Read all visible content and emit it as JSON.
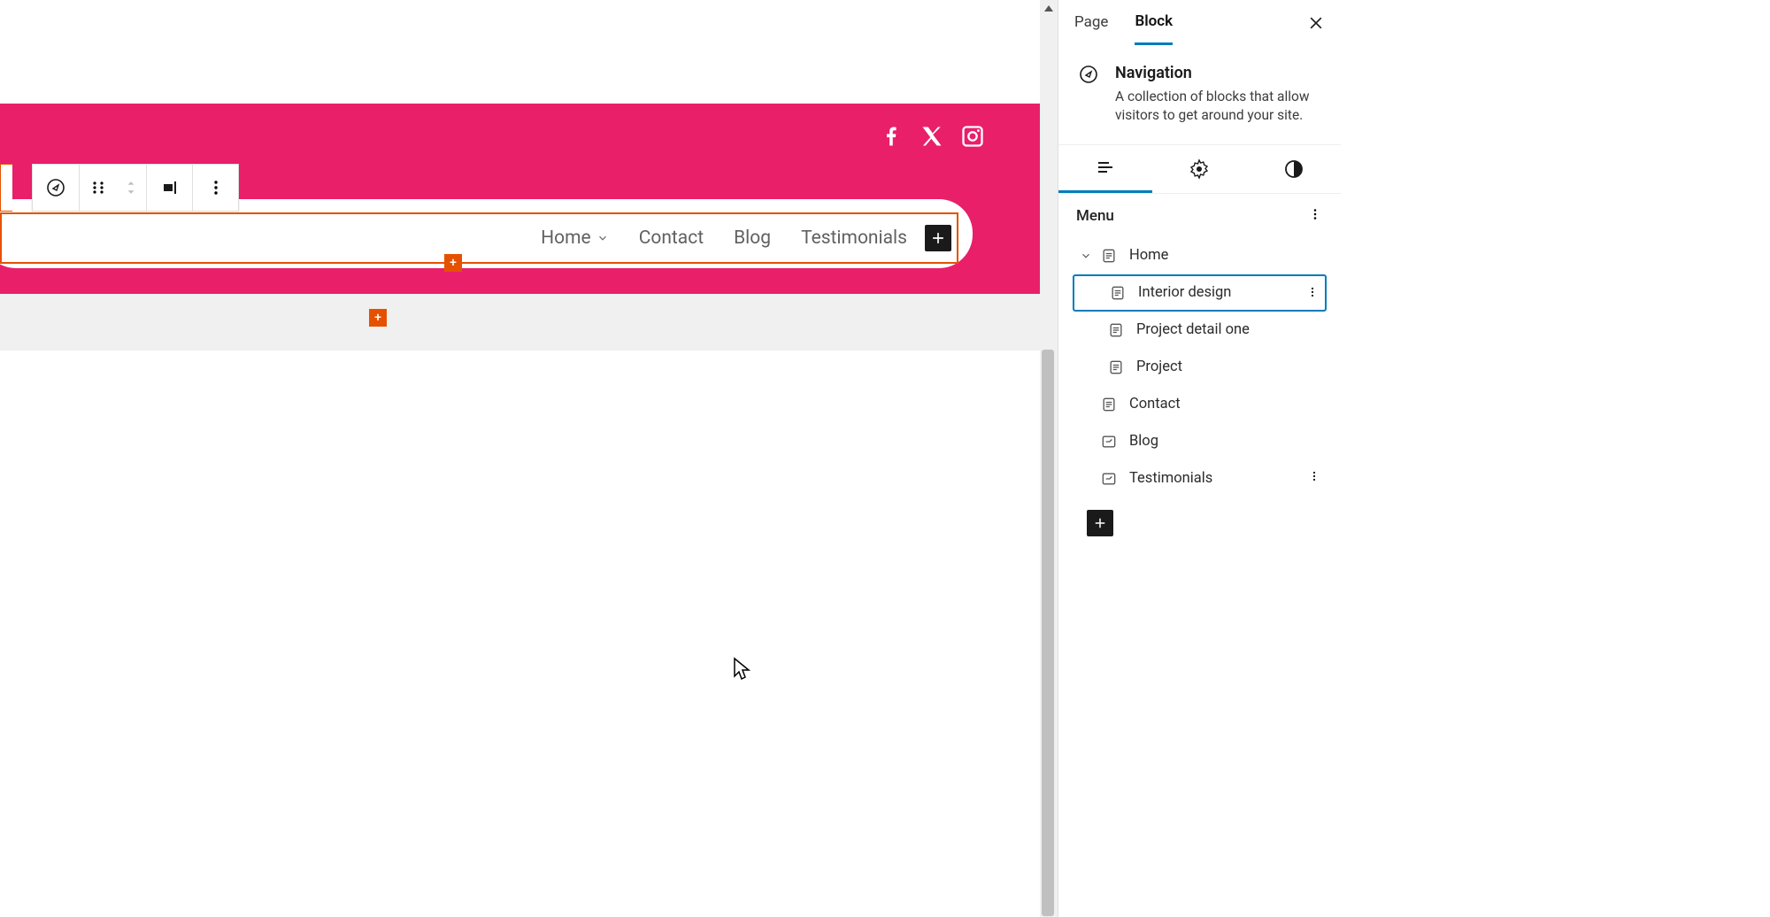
{
  "canvas": {
    "nav_items": [
      "Home",
      "Contact",
      "Blog",
      "Testimonials"
    ],
    "nav_dropdown_index": 0,
    "hero_bg": "#e91f6a",
    "nav_outline": "#e65100",
    "socials": [
      "facebook",
      "x-twitter",
      "instagram"
    ]
  },
  "sidebar": {
    "tabs": {
      "page": "Page",
      "block": "Block",
      "active": "Block"
    },
    "block": {
      "title": "Navigation",
      "desc": "A collection of blocks that allow visitors to get around your site."
    },
    "sub_tabs": {
      "active": "list"
    },
    "menu": {
      "heading": "Menu",
      "items": [
        {
          "label": "Home",
          "level": 0,
          "icon": "page",
          "expandable": true,
          "expanded": true
        },
        {
          "label": "Interior design",
          "level": 1,
          "icon": "page",
          "selected": true
        },
        {
          "label": "Project detail one",
          "level": 1,
          "icon": "page"
        },
        {
          "label": "Project",
          "level": 1,
          "icon": "page"
        },
        {
          "label": "Contact",
          "level": 0,
          "icon": "page"
        },
        {
          "label": "Blog",
          "level": 0,
          "icon": "archive"
        },
        {
          "label": "Testimonials",
          "level": 0,
          "icon": "archive",
          "show_kebab": true
        }
      ]
    }
  }
}
